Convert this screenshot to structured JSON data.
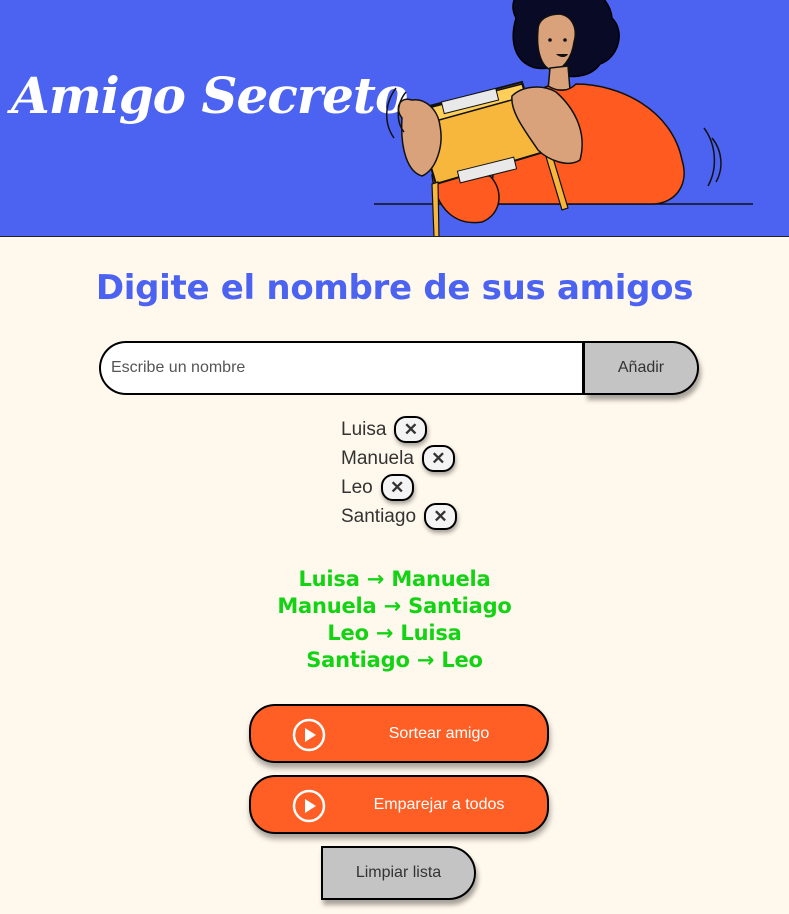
{
  "header": {
    "title": "Amigo Secreto"
  },
  "main": {
    "heading": "Digite el nombre de sus amigos"
  },
  "input": {
    "placeholder": "Escribe un nombre",
    "value": ""
  },
  "buttons": {
    "add_label": "Añadir",
    "draw_label": "Sortear amigo",
    "pair_all_label": "Emparejar a todos",
    "clear_label": "Limpiar lista",
    "remove_glyph": "✕"
  },
  "friends": [
    "Luisa",
    "Manuela",
    "Leo",
    "Santiago"
  ],
  "results": [
    "Luisa → Manuela",
    "Manuela → Santiago",
    "Leo → Luisa",
    "Santiago → Leo"
  ],
  "icons": {
    "play_button": "play-circle-icon",
    "illustration": "person-holding-gift-illustration"
  },
  "colors": {
    "header_bg": "#4b63f0",
    "page_bg": "#fff8ec",
    "heading": "#4b63f0",
    "accent_button": "#ff5f25",
    "result_text": "#14d314",
    "neutral_button": "#c4c4c4"
  }
}
